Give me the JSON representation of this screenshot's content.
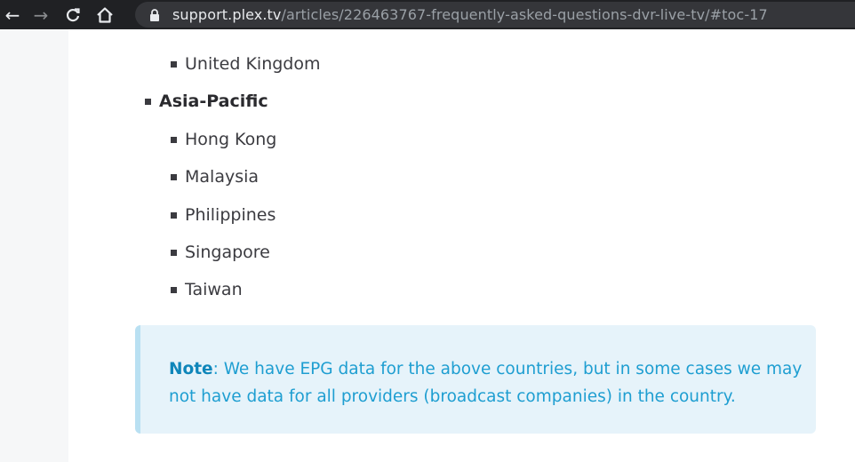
{
  "browser": {
    "url_host": "support.plex.tv",
    "url_path": "/articles/226463767-frequently-asked-questions-dvr-live-tv/#toc-17"
  },
  "regions": {
    "prev_country": "United Kingdom",
    "asia_pacific": {
      "label": "Asia-Pacific",
      "countries": [
        "Hong Kong",
        "Malaysia",
        "Philippines",
        "Singapore",
        "Taiwan"
      ]
    }
  },
  "note": {
    "label": "Note",
    "text": ": We have EPG data for the above countries, but in some cases we may not have data for all providers (broadcast companies) in the country."
  }
}
